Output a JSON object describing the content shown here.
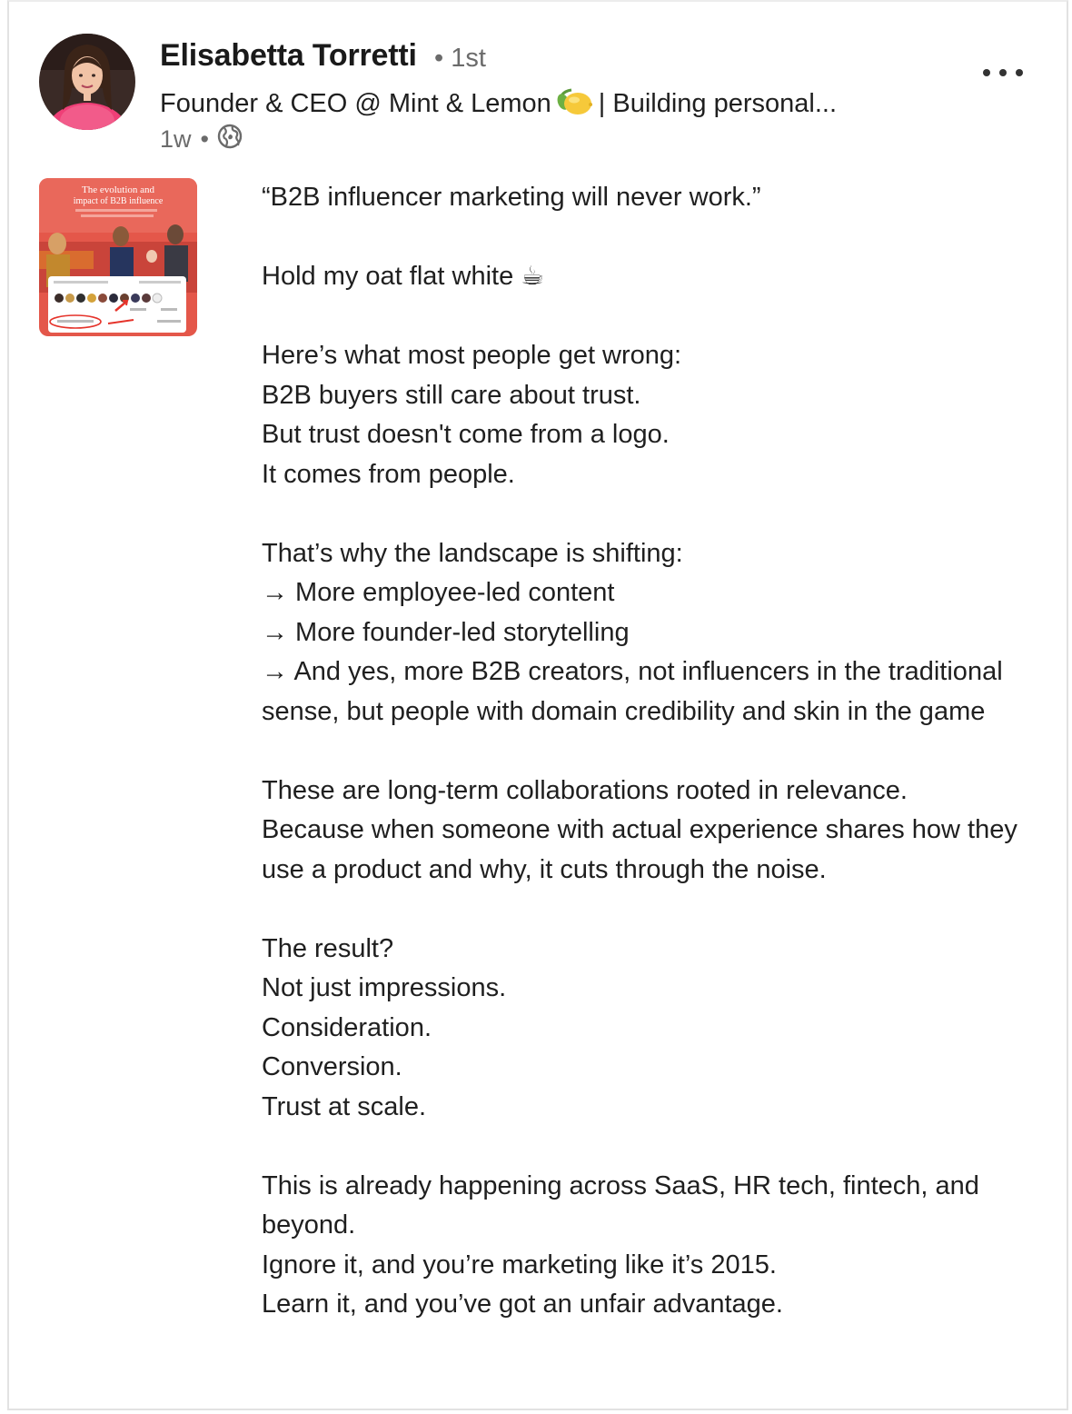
{
  "post": {
    "author": {
      "name": "Elisabetta Torretti",
      "connection_degree": "• 1st",
      "headline_prefix": "Founder & CEO @ Mint & Lemon",
      "headline_suffix": "| Building personal...",
      "headline_emoji": "lemon",
      "timestamp": "1w",
      "visibility_icon": "globe-icon",
      "meta_separator": "•"
    },
    "menu_icon": "more-horizontal-icon",
    "thumbnail": {
      "title_line1": "The evolution and",
      "title_line2": "impact of B2B influence"
    },
    "body": {
      "quote": "“B2B influencer marketing will never work.”",
      "hold": "Hold my oat flat white ☕",
      "p1": [
        "Here’s what most people get wrong:",
        "B2B buyers still care about trust.",
        "But trust doesn't come from a logo.",
        "It comes from people."
      ],
      "p2_intro": "That’s why the landscape is shifting:",
      "p2_items": [
        "→ More employee-led content",
        "→ More founder-led storytelling",
        "→ And yes, more B2B creators, not influencers in the traditional sense, but people with domain credibility and skin in the game"
      ],
      "p3": [
        "These are long-term collaborations rooted in relevance.",
        "Because when someone with actual experience shares how they use a product and why, it cuts through the noise."
      ],
      "p4": [
        "The result?",
        "Not just impressions.",
        "Consideration.",
        "Conversion.",
        "Trust at scale."
      ],
      "p5": [
        "This is already happening across SaaS, HR tech, fintech, and beyond.",
        "Ignore it, and you’re marketing like it’s 2015.",
        "Learn it, and you’ve got an unfair advantage."
      ]
    }
  },
  "colors": {
    "name": "#1a1a1a",
    "muted": "#6b6b6b",
    "body_text": "#1f1f1f",
    "border": "#e2e2e2",
    "thumb_bg": "#e4574a"
  }
}
